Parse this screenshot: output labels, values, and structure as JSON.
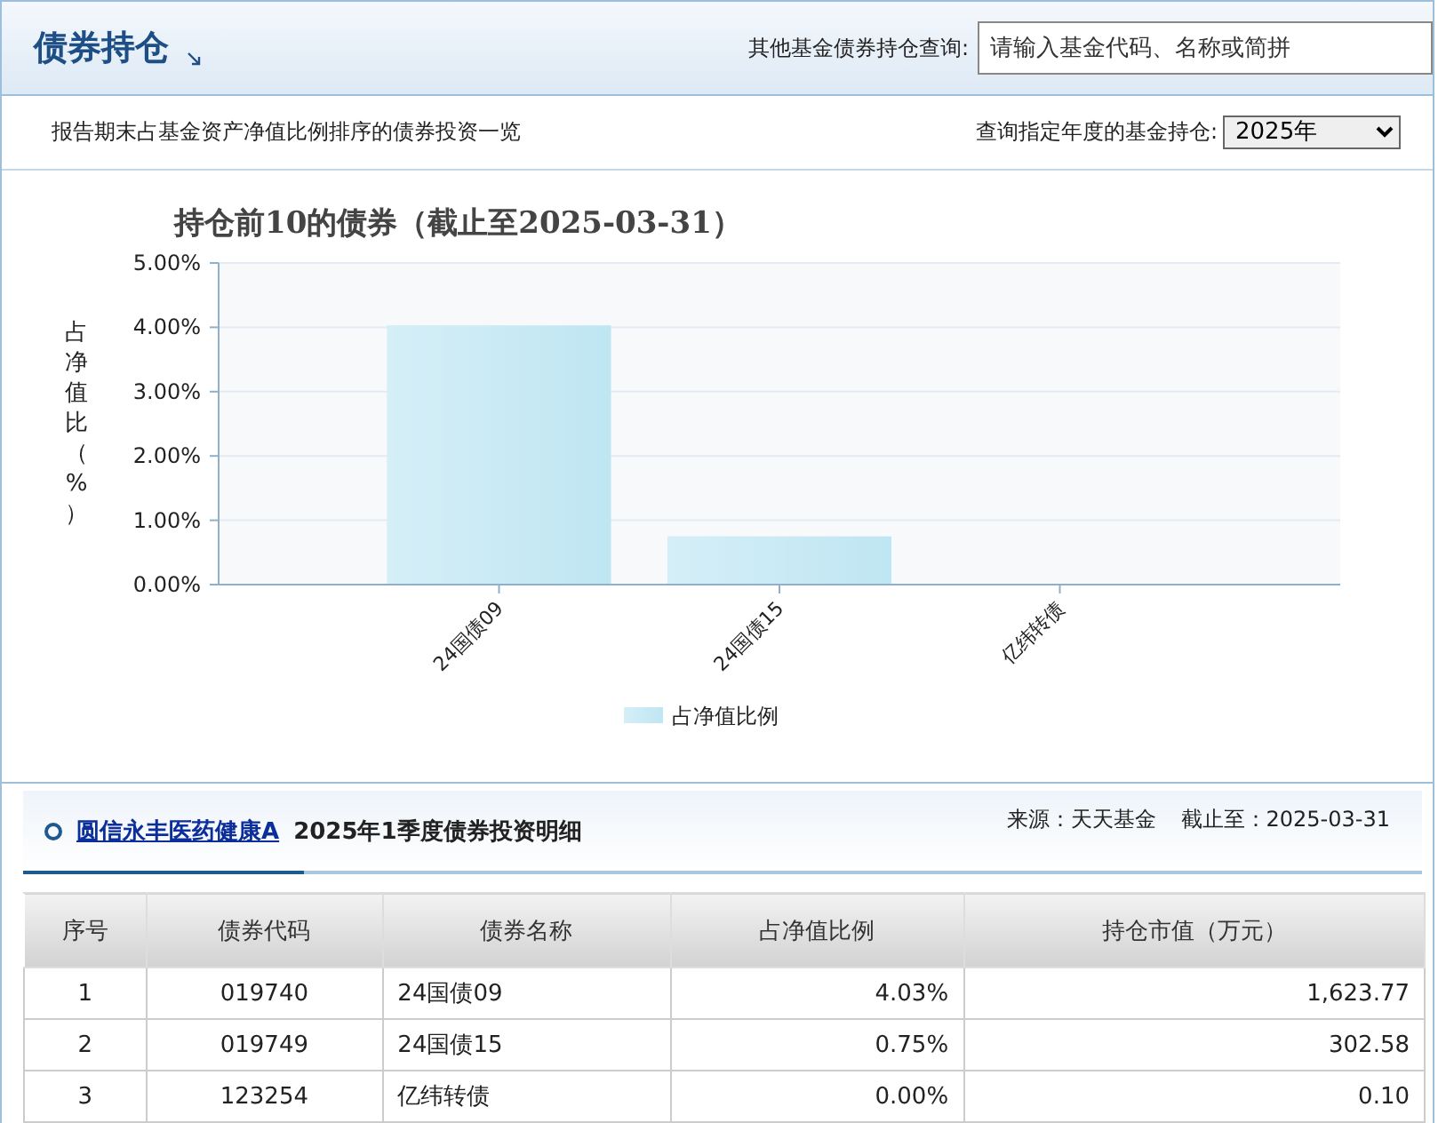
{
  "header": {
    "title": "债券持仓",
    "search_label": "其他基金债券持仓查询:",
    "search_placeholder": "请输入基金代码、名称或简拼"
  },
  "subheader": {
    "description": "报告期末占基金资产净值比例排序的债券投资一览",
    "year_label": "查询指定年度的基金持仓:",
    "year_value": "2025年"
  },
  "chart": {
    "chart_data": {
      "type": "bar",
      "title": "持仓前10的债券（截止至2025-03-31）",
      "ylabel": "占净值比（%）",
      "categories": [
        "24国债09",
        "24国债15",
        "亿纬转债"
      ],
      "series": [
        {
          "name": "占净值比例",
          "color": "#bfe6f3",
          "values": [
            4.03,
            0.75,
            0.0
          ]
        }
      ],
      "grid": true,
      "ylim": [
        0,
        5
      ],
      "yticks": [
        {
          "value": 0,
          "label": "0.00%"
        },
        {
          "value": 1,
          "label": "1.00%"
        },
        {
          "value": 2,
          "label": "2.00%"
        },
        {
          "value": 3,
          "label": "3.00%"
        },
        {
          "value": 4,
          "label": "4.00%"
        },
        {
          "value": 5,
          "label": "5.00%"
        }
      ]
    }
  },
  "detail": {
    "fund_link": "圆信永丰医药健康A",
    "title": "2025年1季度债券投资明细",
    "source": "来源：天天基金",
    "date": "截止至：2025-03-31",
    "table": {
      "columns": [
        "序号",
        "债券代码",
        "债券名称",
        "占净值比例",
        "持仓市值（万元）"
      ],
      "rows": [
        [
          "1",
          "019740",
          "24国债09",
          "4.03%",
          "1,623.77"
        ],
        [
          "2",
          "019749",
          "24国债15",
          "0.75%",
          "302.58"
        ],
        [
          "3",
          "123254",
          "亿纬转债",
          "0.00%",
          "0.10"
        ]
      ]
    }
  }
}
